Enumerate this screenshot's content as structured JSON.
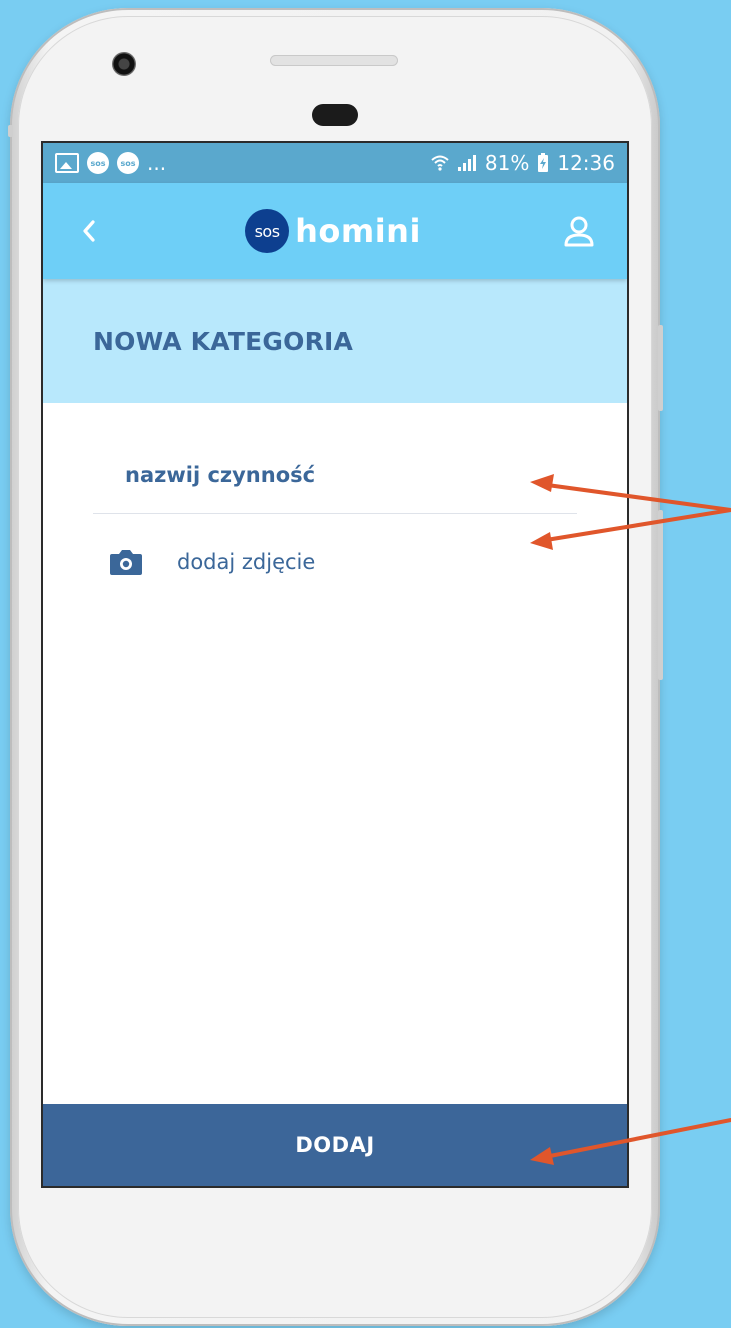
{
  "status_bar": {
    "left_more": "...",
    "sos_badge": "sos",
    "battery": "81%",
    "time": "12:36"
  },
  "app_bar": {
    "logo_badge": "sos",
    "logo_text": "homini"
  },
  "page": {
    "title": "NOWA KATEGORIA"
  },
  "form": {
    "name_placeholder": "nazwij czynność",
    "photo_label": "dodaj zdjęcie"
  },
  "actions": {
    "submit_label": "DODAJ"
  },
  "colors": {
    "background": "#79cdf2",
    "app_bar": "#6ecff7",
    "title_band": "#b8e8fc",
    "primary_text": "#3b6799",
    "submit_bar": "#3c6699",
    "annotation_arrow": "#e0562b"
  }
}
